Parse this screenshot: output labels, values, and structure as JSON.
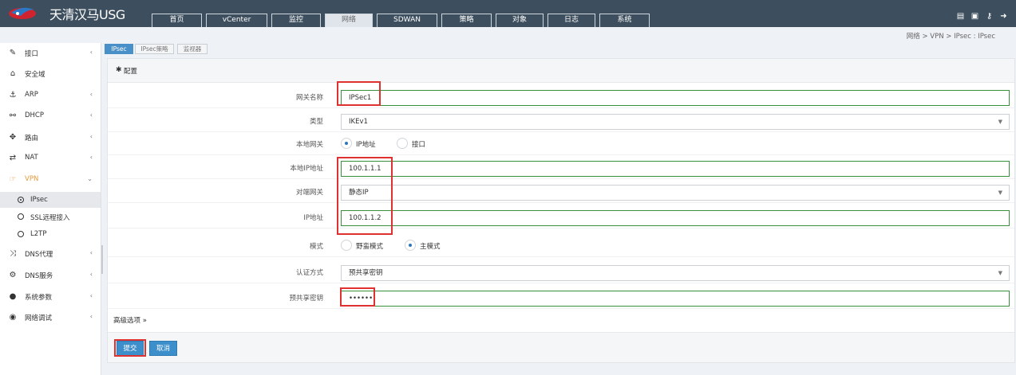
{
  "app": {
    "title": "天清汉马USG"
  },
  "nav": {
    "tabs": [
      "首页",
      "vCenter",
      "监控",
      "网络",
      "SDWAN",
      "策略",
      "对象",
      "日志",
      "系统"
    ],
    "active": "网络"
  },
  "top_icons": [
    "document-icon",
    "save-icon",
    "key-icon",
    "logout-icon"
  ],
  "breadcrumb": "网络 > VPN > IPsec : IPsec",
  "sidebar": {
    "items": [
      {
        "label": "接口",
        "icon": "plug-icon",
        "chevron": "‹"
      },
      {
        "label": "安全域",
        "icon": "bank-icon",
        "chevron": ""
      },
      {
        "label": "ARP",
        "icon": "arp-icon",
        "chevron": "‹"
      },
      {
        "label": "DHCP",
        "icon": "sitemap-icon",
        "chevron": "‹"
      },
      {
        "label": "路由",
        "icon": "arrows-icon",
        "chevron": "‹"
      },
      {
        "label": "NAT",
        "icon": "exchange-icon",
        "chevron": "‹"
      },
      {
        "label": "VPN",
        "icon": "hand-icon",
        "chevron": "⌄"
      }
    ],
    "vpn_subitems": [
      "IPsec",
      "SSL远程接入",
      "L2TP"
    ],
    "items_after": [
      {
        "label": "DNS代理",
        "icon": "random-icon",
        "chevron": "‹"
      },
      {
        "label": "DNS服务",
        "icon": "cogs-icon",
        "chevron": "‹"
      },
      {
        "label": "系统参数",
        "icon": "globe-icon",
        "chevron": "‹"
      },
      {
        "label": "网络调试",
        "icon": "target-icon",
        "chevron": "‹"
      }
    ]
  },
  "subtabs": [
    "IPsec",
    "IPsec策略",
    "监视器"
  ],
  "panel": {
    "title": "配置"
  },
  "form": {
    "gateway_name": {
      "label": "网关名称",
      "value": "IPSec1"
    },
    "type": {
      "label": "类型",
      "value": "IKEv1"
    },
    "local_gateway": {
      "label": "本地网关",
      "options": [
        "IP地址",
        "接口"
      ],
      "selected": "IP地址"
    },
    "local_ip": {
      "label": "本地IP地址",
      "value": "100.1.1.1"
    },
    "peer_gateway": {
      "label": "对端网关",
      "value": "静态IP"
    },
    "ip_address": {
      "label": "IP地址",
      "value": "100.1.1.2"
    },
    "mode": {
      "label": "模式",
      "options": [
        "野蛮模式",
        "主模式"
      ],
      "selected": "主模式"
    },
    "auth_method": {
      "label": "认证方式",
      "value": "预共享密钥"
    },
    "psk": {
      "label": "预共享密钥",
      "value": "••••••"
    }
  },
  "advanced_link": "高级选项 »",
  "buttons": {
    "submit": "提交",
    "cancel": "取消"
  },
  "colors": {
    "topbar": "#3d4f5e",
    "accent": "#3d8fcc",
    "highlight": "#e03131",
    "valid_border": "#3a8f3a"
  }
}
